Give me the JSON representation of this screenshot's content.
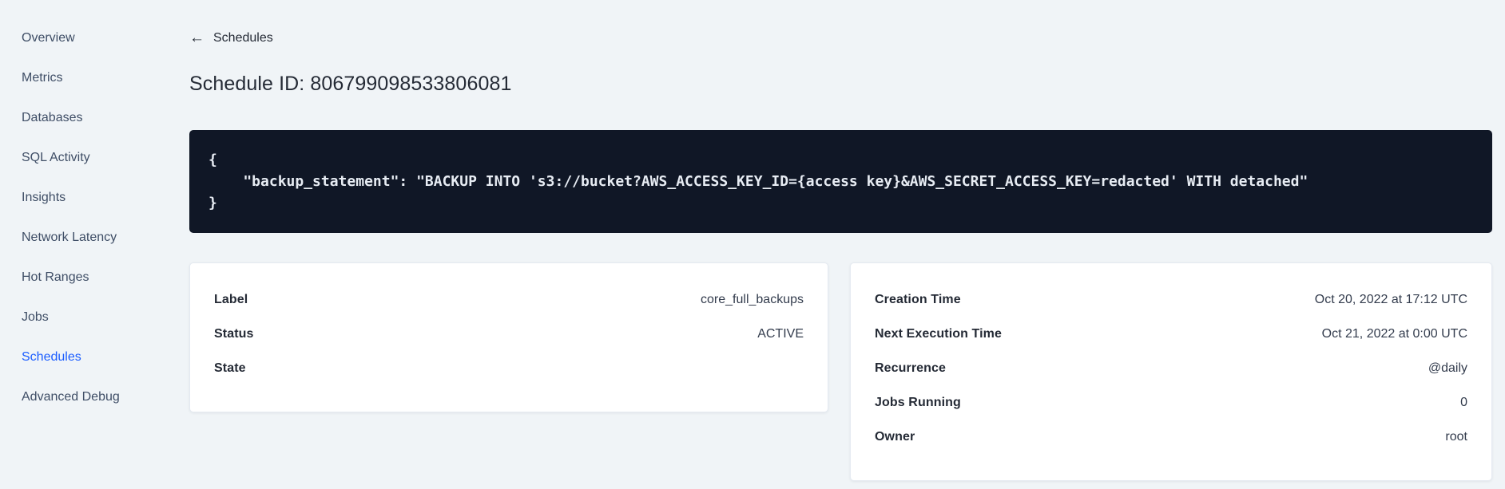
{
  "sidebar": {
    "active_item": "Schedules",
    "items": [
      {
        "label": "Overview"
      },
      {
        "label": "Metrics"
      },
      {
        "label": "Databases"
      },
      {
        "label": "SQL Activity"
      },
      {
        "label": "Insights"
      },
      {
        "label": "Network Latency"
      },
      {
        "label": "Hot Ranges"
      },
      {
        "label": "Jobs"
      },
      {
        "label": "Schedules"
      },
      {
        "label": "Advanced Debug"
      }
    ]
  },
  "header": {
    "back_icon": "←",
    "back_label": "Schedules",
    "title": "Schedule ID: 806799098533806081"
  },
  "code_block": {
    "lines": [
      "{",
      "    \"backup_statement\": \"BACKUP INTO 's3://bucket?AWS_ACCESS_KEY_ID={access key}&AWS_SECRET_ACCESS_KEY=redacted' WITH detached\"",
      "}"
    ]
  },
  "cards": {
    "left": {
      "rows": [
        {
          "label": "Label",
          "value": "core_full_backups"
        },
        {
          "label": "Status",
          "value": "ACTIVE"
        },
        {
          "label": "State",
          "value": ""
        }
      ]
    },
    "right": {
      "rows": [
        {
          "label": "Creation Time",
          "value": "Oct 20, 2022 at 17:12 UTC"
        },
        {
          "label": "Next Execution Time",
          "value": "Oct 21, 2022 at 0:00 UTC"
        },
        {
          "label": "Recurrence",
          "value": "@daily"
        },
        {
          "label": "Jobs Running",
          "value": "0"
        },
        {
          "label": "Owner",
          "value": "root"
        }
      ]
    }
  },
  "colors": {
    "accent_blue": "#1b5dff",
    "page_background": "#f0f4f7",
    "code_background": "#101726",
    "code_text": "#e7ecf3",
    "text_dark": "#242a35",
    "sidebar_text": "#3f4e66"
  }
}
